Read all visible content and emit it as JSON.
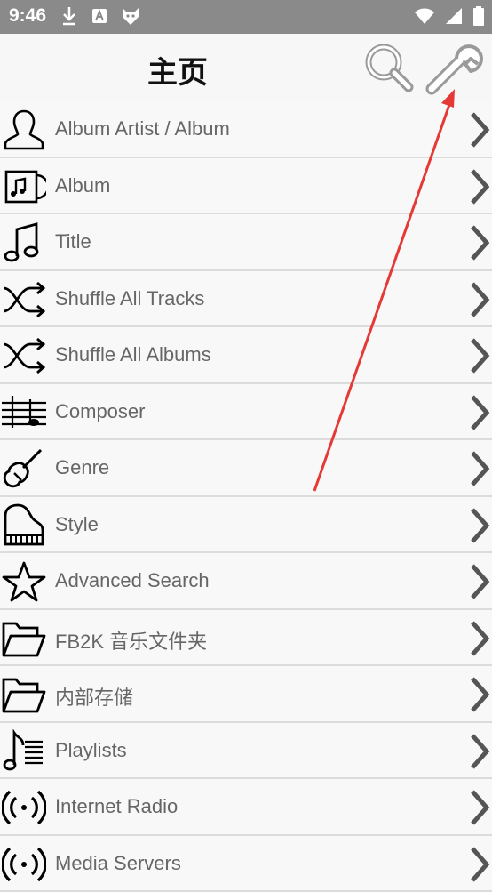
{
  "status_bar": {
    "time": "9:46"
  },
  "header": {
    "title": "主页"
  },
  "menu": [
    {
      "label": "Album Artist / Album",
      "icon": "person-icon"
    },
    {
      "label": "Album",
      "icon": "album-icon"
    },
    {
      "label": "Title",
      "icon": "music-note-icon"
    },
    {
      "label": "Shuffle All Tracks",
      "icon": "shuffle-icon"
    },
    {
      "label": "Shuffle All Albums",
      "icon": "shuffle-icon"
    },
    {
      "label": "Composer",
      "icon": "staff-icon"
    },
    {
      "label": "Genre",
      "icon": "violin-icon"
    },
    {
      "label": "Style",
      "icon": "piano-icon"
    },
    {
      "label": "Advanced Search",
      "icon": "star-icon"
    },
    {
      "label": "FB2K 音乐文件夹",
      "icon": "folder-icon"
    },
    {
      "label": "内部存储",
      "icon": "folder-icon"
    },
    {
      "label": "Playlists",
      "icon": "playlist-icon"
    },
    {
      "label": "Internet Radio",
      "icon": "radio-icon"
    },
    {
      "label": "Media Servers",
      "icon": "radio-icon"
    }
  ],
  "colors": {
    "status_bar": "#8a8a8a",
    "annotation_arrow": "#e53935",
    "label": "#666666",
    "chevron": "#555555"
  }
}
